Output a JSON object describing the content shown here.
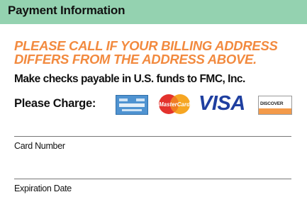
{
  "header": {
    "title": "Payment Information",
    "color": "#94d2b0"
  },
  "notice": {
    "line1": "PLEASE CALL IF YOUR BILLING ADDRESS",
    "line2": "DIFFERS FROM THE ADDRESS ABOVE.",
    "color": "#f28a3f"
  },
  "checks_text": "Make checks payable in U.S. funds to FMC, Inc.",
  "charge": {
    "label": "Please Charge:",
    "cards": [
      {
        "icon": "amex-card-icon"
      },
      {
        "icon": "mastercard-card-icon",
        "text": "MasterCard"
      },
      {
        "icon": "visa-card-icon",
        "text": "VISA"
      },
      {
        "icon": "discover-card-icon",
        "text": "DISCOVER"
      }
    ]
  },
  "fields": {
    "card_number_label": "Card Number",
    "expiration_label": "Expiration Date"
  }
}
